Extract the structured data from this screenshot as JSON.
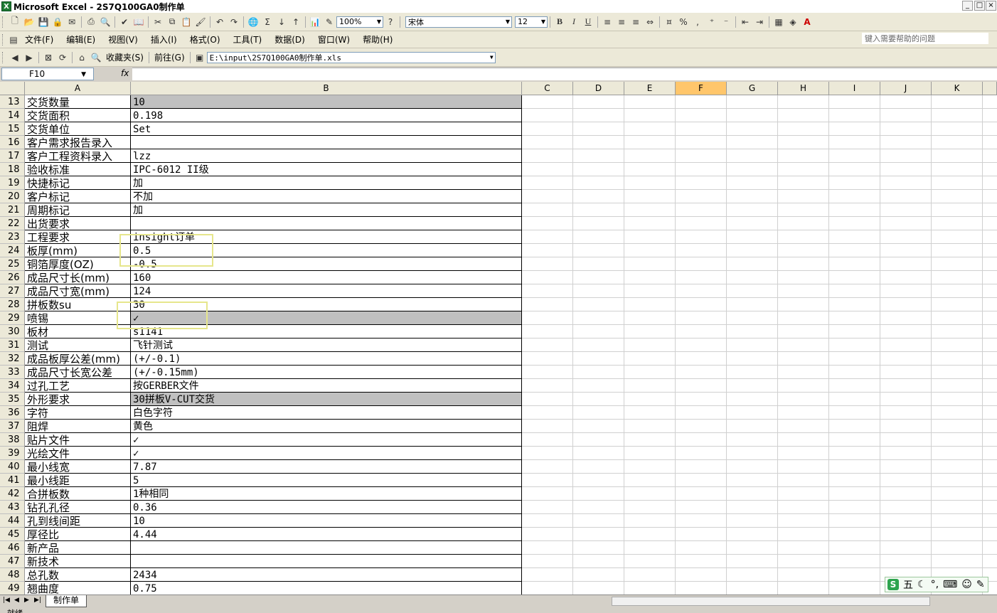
{
  "title": "Microsoft Excel - 2S7Q100GA0制作单",
  "window_buttons": [
    "_",
    "□",
    "×"
  ],
  "toolbar": {
    "zoom": "100%",
    "font": "宋体",
    "size": "12",
    "bold": "B",
    "italic": "I",
    "underline": "U",
    "percent": "%",
    "comma": ","
  },
  "menu": [
    "文件(F)",
    "编辑(E)",
    "视图(V)",
    "插入(I)",
    "格式(O)",
    "工具(T)",
    "数据(D)",
    "窗口(W)",
    "帮助(H)"
  ],
  "help_placeholder": "键入需要帮助的问题",
  "web": {
    "favorites": "收藏夹(S)",
    "goto": "前往(G)",
    "address": "E:\\input\\2S7Q100GA0制作单.xls"
  },
  "namebox": "F10",
  "fx": "fx",
  "columns": [
    "A",
    "B",
    "C",
    "D",
    "E",
    "F",
    "G",
    "H",
    "I",
    "J",
    "K"
  ],
  "selected_column": "F",
  "rows": [
    {
      "n": "13",
      "a": "交货数量",
      "b": "10",
      "gray": true
    },
    {
      "n": "14",
      "a": "交货面积",
      "b": "0.198",
      "gray": false
    },
    {
      "n": "15",
      "a": "交货单位",
      "b": "Set",
      "gray": false
    },
    {
      "n": "16",
      "a": "客户需求报告录入",
      "b": "",
      "gray": false
    },
    {
      "n": "17",
      "a": "客户工程资料录入",
      "b": "lzz",
      "gray": false
    },
    {
      "n": "18",
      "a": "验收标准",
      "b": "IPC-6012 II级",
      "gray": false
    },
    {
      "n": "19",
      "a": "快捷标记",
      "b": "加",
      "gray": false
    },
    {
      "n": "20",
      "a": "客户标记",
      "b": "不加",
      "gray": false
    },
    {
      "n": "21",
      "a": "周期标记",
      "b": "加",
      "gray": false
    },
    {
      "n": "22",
      "a": "出货要求",
      "b": "",
      "gray": false
    },
    {
      "n": "23",
      "a": "工程要求",
      "b": "insight订单",
      "gray": false
    },
    {
      "n": "24",
      "a": "板厚(mm)",
      "b": "0.5",
      "gray": false
    },
    {
      "n": "25",
      "a": "铜箔厚度(OZ)",
      "b": "-0.5",
      "gray": false
    },
    {
      "n": "26",
      "a": "成品尺寸长(mm)",
      "b": "160",
      "gray": false
    },
    {
      "n": "27",
      "a": "成品尺寸宽(mm)",
      "b": "124",
      "gray": false
    },
    {
      "n": "28",
      "a": "拼板数su",
      "b": "30",
      "gray": false
    },
    {
      "n": "29",
      "a": "喷锡",
      "b": "✓",
      "gray": true
    },
    {
      "n": "30",
      "a": "板材",
      "b": "s1141",
      "gray": false
    },
    {
      "n": "31",
      "a": "测试",
      "b": "飞针测试",
      "gray": false
    },
    {
      "n": "32",
      "a": "成品板厚公差(mm)",
      "b": "(+/-0.1)",
      "gray": false
    },
    {
      "n": "33",
      "a": "成品尺寸长宽公差",
      "b": "(+/-0.15mm)",
      "gray": false
    },
    {
      "n": "34",
      "a": "过孔工艺",
      "b": "按GERBER文件",
      "gray": false
    },
    {
      "n": "35",
      "a": "外形要求",
      "b": "30拼板V-CUT交货",
      "gray": true
    },
    {
      "n": "36",
      "a": "字符",
      "b": "白色字符",
      "gray": false
    },
    {
      "n": "37",
      "a": "阻焊",
      "b": "黄色",
      "gray": false
    },
    {
      "n": "38",
      "a": "贴片文件",
      "b": "✓",
      "gray": false
    },
    {
      "n": "39",
      "a": "光绘文件",
      "b": "✓",
      "gray": false
    },
    {
      "n": "40",
      "a": "最小线宽",
      "b": "7.87",
      "gray": false
    },
    {
      "n": "41",
      "a": "最小线距",
      "b": "5",
      "gray": false
    },
    {
      "n": "42",
      "a": "合拼板数",
      "b": "1种相同",
      "gray": false
    },
    {
      "n": "43",
      "a": "钻孔孔径",
      "b": "0.36",
      "gray": false
    },
    {
      "n": "44",
      "a": "孔到线间距",
      "b": "10",
      "gray": false
    },
    {
      "n": "45",
      "a": "厚径比",
      "b": "4.44",
      "gray": false
    },
    {
      "n": "46",
      "a": "新产品",
      "b": "",
      "gray": false
    },
    {
      "n": "47",
      "a": "新技术",
      "b": "",
      "gray": false
    },
    {
      "n": "48",
      "a": "总孔数",
      "b": "2434",
      "gray": false
    },
    {
      "n": "49",
      "a": "翘曲度",
      "b": "0.75",
      "gray": false
    }
  ],
  "sheet_tab": "制作单",
  "status": "就绪",
  "ime": {
    "label": "五",
    "badge": "S"
  },
  "colors": {
    "highlight": "#e6e68c",
    "gray_cell": "#c0c0c0",
    "selected_header": "#ffc66b"
  }
}
